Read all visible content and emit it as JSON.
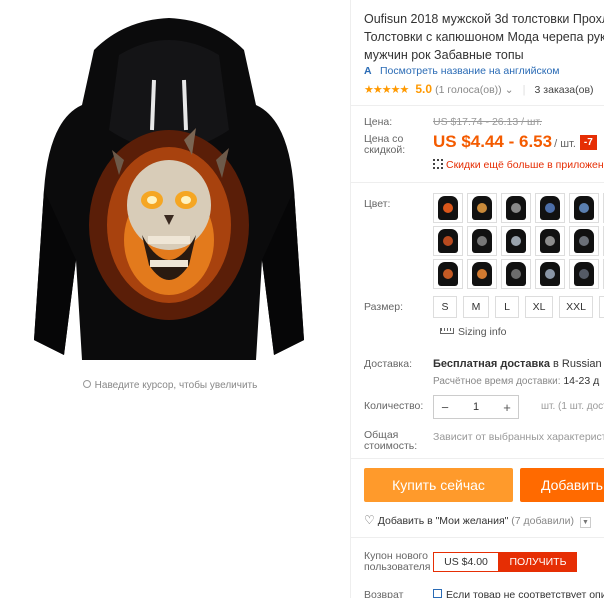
{
  "gallery": {
    "zoom_hint": "Наведите курсор, чтобы увеличить"
  },
  "product": {
    "title_lines": [
      "Oufisun 2018 мужской 3d толстовки Прохл",
      "Толстовки с капюшоном Мода черепа рук",
      "мужчин рок Забавные топы"
    ],
    "translate_link": "Посмотреть название на английском",
    "rating": {
      "stars": "★★★★★",
      "value": "5.0",
      "count": "(1 голоса(ов))",
      "orders": "3 заказа(ов)"
    }
  },
  "price": {
    "label_price": "Цена:",
    "old": "US $17.74 - 26.13 / шт.",
    "label_discount_lines": [
      "Цена со",
      "скидкой:"
    ],
    "new": "US $4.44 - 6.53",
    "unit": "/ шт.",
    "badge": "-7",
    "app_discount": "Скидки ещё больше в приложен"
  },
  "colors": {
    "label": "Цвет:",
    "swatches": [
      {
        "face": "#d9561a"
      },
      {
        "face": "#c98a3a"
      },
      {
        "face": "#888888"
      },
      {
        "face": "#4c6ea8"
      },
      {
        "face": "#5a7fb0"
      },
      {
        "face": "#444444"
      },
      {
        "face": "#b84a1f"
      },
      {
        "face": "#777777"
      },
      {
        "face": "#9aa3ad"
      },
      {
        "face": "#8c8c8c"
      },
      {
        "face": "#6b7078"
      },
      {
        "face": "#3a3a3a"
      },
      {
        "face": "#c45a24"
      },
      {
        "face": "#d27a30"
      },
      {
        "face": "#6d6d6d"
      },
      {
        "face": "#8a96a6"
      },
      {
        "face": "#555b66"
      },
      {
        "face": "#c35f25"
      }
    ]
  },
  "sizes": {
    "label": "Размер:",
    "options": [
      "S",
      "M",
      "L",
      "XL",
      "XXL",
      ""
    ],
    "sizing_info": "Sizing info"
  },
  "shipping": {
    "label": "Доставка:",
    "main_bold": "Бесплатная доставка",
    "main_rest": " в Russian Fed",
    "time_label": "Расчётное время доставки: ",
    "time_value": "14-23 д"
  },
  "quantity": {
    "label": "Количество:",
    "minus": "−",
    "value": "1",
    "plus": "+",
    "stock": "шт. (1 шт. доступн"
  },
  "total": {
    "label_lines": [
      "Общая",
      "стоимость:"
    ],
    "note": "Зависит от выбранных характеристи"
  },
  "actions": {
    "buy_now": "Купить сейчас",
    "add_to_cart": "Добавить",
    "wishlist_text": "Добавить в \"Мои желания\"",
    "wishlist_count": "(7 добавили)"
  },
  "coupon": {
    "label_lines": [
      "Купон нового",
      "пользователя"
    ],
    "amount": "US $4.00",
    "get": "ПОЛУЧИТЬ"
  },
  "returns": {
    "label": "Возврат",
    "text": "Если товар не соответствует опи"
  }
}
